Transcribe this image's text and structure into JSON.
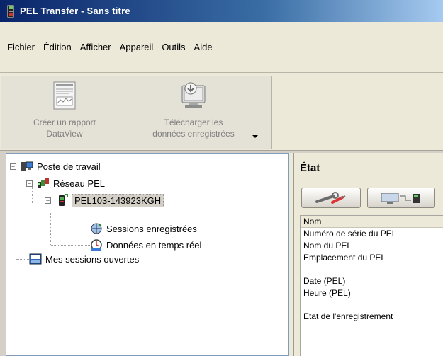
{
  "window": {
    "title": "PEL Transfer - Sans titre"
  },
  "menu": [
    "Fichier",
    "Édition",
    "Afficher",
    "Appareil",
    "Outils",
    "Aide"
  ],
  "toolbar": {
    "report": {
      "line1": "Créer un rapport",
      "line2": "DataView"
    },
    "download": {
      "line1": "Télécharger les",
      "line2": "données enregistrées"
    }
  },
  "tree": {
    "root": "Poste de travail",
    "network": "Réseau PEL",
    "device": "PEL103-143923KGH",
    "sessions": "Sessions enregistrées",
    "realtime": "Données en temps réel",
    "open_sessions": "Mes sessions ouvertes"
  },
  "state_panel": {
    "title": "État",
    "rows": [
      "Nom",
      "Numéro de série du PEL",
      "Nom du PEL",
      "Emplacement du PEL",
      "",
      "Date (PEL)",
      "Heure (PEL)",
      "",
      "Etat de l'enregistrement"
    ]
  },
  "colors": {
    "title_start": "#0a246a",
    "title_end": "#a6caf0",
    "panel_bg": "#ece9d8",
    "tree_bg": "#ffffff"
  }
}
